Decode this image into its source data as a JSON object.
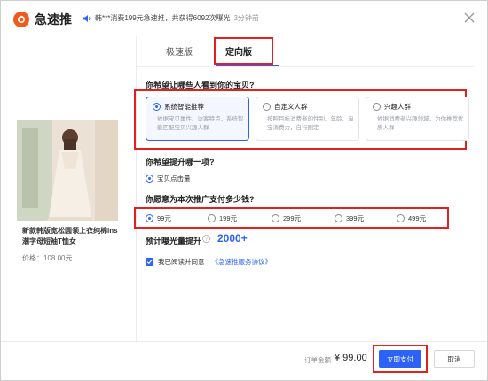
{
  "header": {
    "app_title": "急速推",
    "ticker_text": "韩***消费199元急速推，共获得6092次曝光",
    "ticker_time": "3分钟前"
  },
  "product": {
    "title": "新款韩版宽松圆领上衣纯棉ins潮字母短袖T恤女",
    "price": "价格：108.00元"
  },
  "tabs": [
    {
      "label": "极速版"
    },
    {
      "label": "定向版"
    }
  ],
  "audience": {
    "question": "你希望让哪些人看到你的宝贝?",
    "cards": [
      {
        "title": "系统智能推荐",
        "desc": "依据宝贝属性、访客特点，系统智能匹配宝贝兴趣人群"
      },
      {
        "title": "自定义人群",
        "desc": "按照目标消费者的性别、年龄、淘宝消费力，自行圈定"
      },
      {
        "title": "兴趣人群",
        "desc": "依据消费者兴趣领域，为你推荐优质人群"
      }
    ]
  },
  "boost": {
    "question": "你希望提升哪一项?",
    "option": "宝贝点击量"
  },
  "budget": {
    "question": "你愿意为本次推广支付多少钱?",
    "options": [
      "99元",
      "199元",
      "299元",
      "399元",
      "499元"
    ]
  },
  "exposure": {
    "label": "预计曝光量提升",
    "value": "2000+"
  },
  "agreement": {
    "text": "我已阅读并同意",
    "link": "《急速推服务协议》"
  },
  "footer": {
    "amount_label": "订单金额",
    "amount_value": "¥ 99.00",
    "pay_label": "立即支付",
    "cancel_label": "取消"
  },
  "colors": {
    "accent": "#2c62f5",
    "brand": "#f05a1e",
    "highlight_box": "#e12020"
  }
}
